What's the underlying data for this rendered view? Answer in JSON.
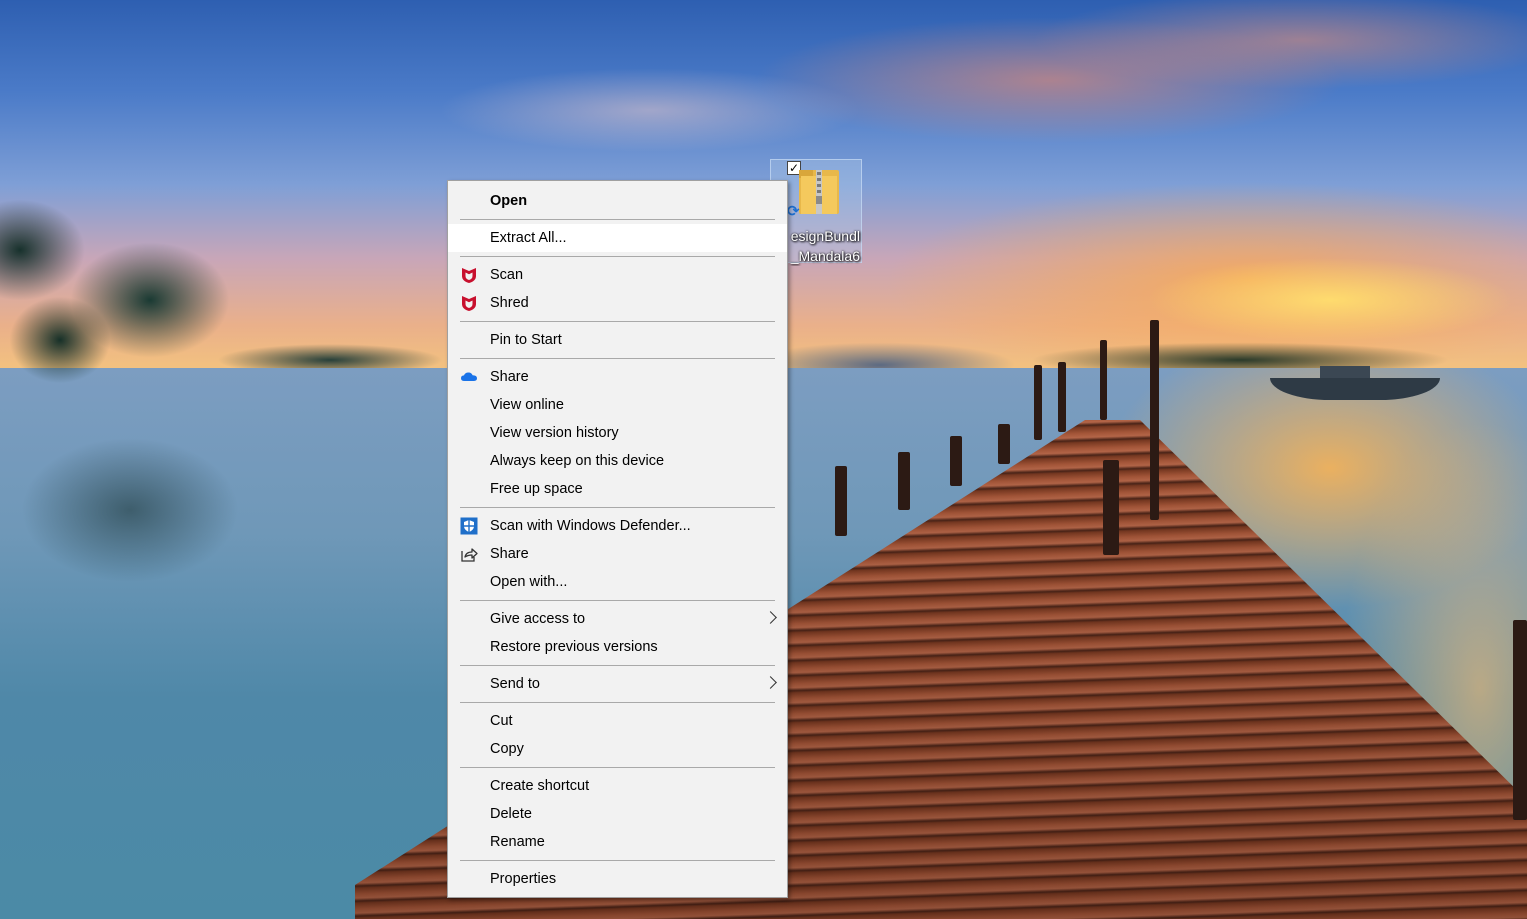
{
  "desktop": {
    "icon": {
      "label_line1": "esignBundl",
      "label_line2": "_Mandala6",
      "checked": "✓",
      "sync_glyph": "⟳",
      "icon_name": "zip-folder-icon"
    }
  },
  "menu": {
    "open": "Open",
    "extract_all": "Extract All...",
    "scan": "Scan",
    "shred": "Shred",
    "pin_to_start": "Pin to Start",
    "onedrive_share": "Share",
    "view_online": "View online",
    "view_version_history": "View version history",
    "always_keep": "Always keep on this device",
    "free_up_space": "Free up space",
    "scan_defender": "Scan with Windows Defender...",
    "share": "Share",
    "open_with": "Open with...",
    "give_access_to": "Give access to",
    "restore_previous": "Restore previous versions",
    "send_to": "Send to",
    "cut": "Cut",
    "copy": "Copy",
    "create_shortcut": "Create shortcut",
    "delete": "Delete",
    "rename": "Rename",
    "properties": "Properties"
  },
  "colors": {
    "mcafee_red": "#c8102e",
    "onedrive_blue": "#1a73e8",
    "defender_blue": "#1f6fc9",
    "menu_bg": "#f2f2f2",
    "menu_hover": "#ffffff"
  }
}
